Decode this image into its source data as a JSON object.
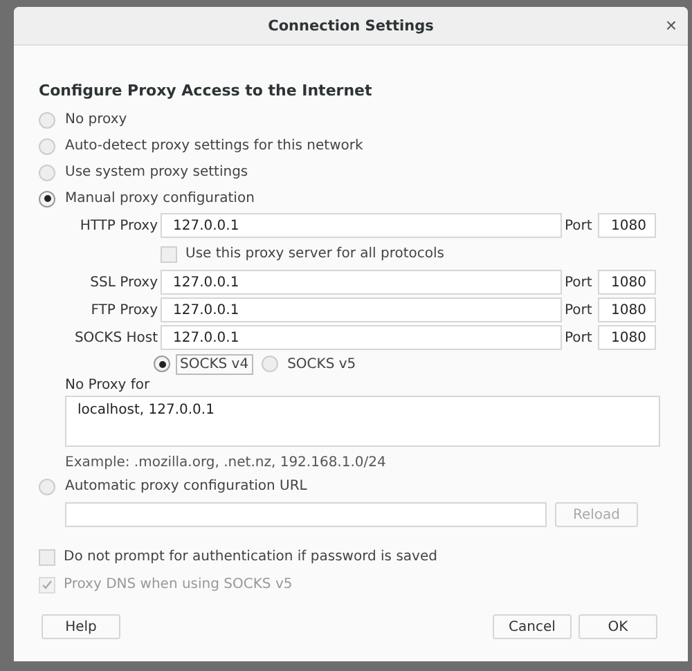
{
  "window": {
    "title": "Connection Settings",
    "close": "×"
  },
  "heading": "Configure Proxy Access to the Internet",
  "modes": [
    {
      "label": "No proxy",
      "selected": false
    },
    {
      "label": "Auto-detect proxy settings for this network",
      "selected": false
    },
    {
      "label": "Use system proxy settings",
      "selected": false
    },
    {
      "label": "Manual proxy configuration",
      "selected": true
    },
    {
      "label": "Automatic proxy configuration URL",
      "selected": false
    }
  ],
  "proxies": [
    {
      "label": "HTTP Proxy",
      "value": "127.0.0.1",
      "port_label": "Port",
      "port": "1080"
    },
    {
      "label": "SSL Proxy",
      "value": "127.0.0.1",
      "port_label": "Port",
      "port": "1080"
    },
    {
      "label": "FTP Proxy",
      "value": "127.0.0.1",
      "port_label": "Port",
      "port": "1080"
    },
    {
      "label": "SOCKS Host",
      "value": "127.0.0.1",
      "port_label": "Port",
      "port": "1080"
    }
  ],
  "share_all": {
    "label": "Use this proxy server for all protocols",
    "checked": false,
    "disabled": false
  },
  "socks_versions": [
    {
      "label": "SOCKS v4",
      "selected": true
    },
    {
      "label": "SOCKS v5",
      "selected": false
    }
  ],
  "no_proxy": {
    "label": "No Proxy for",
    "value": "localhost, 127.0.0.1"
  },
  "example": "Example: .mozilla.org, .net.nz, 192.168.1.0/24",
  "reload": {
    "label": "Reload",
    "disabled": true
  },
  "options": [
    {
      "label": "Do not prompt for authentication if password is saved",
      "checked": false,
      "disabled": false
    },
    {
      "label": "Proxy DNS when using SOCKS v5",
      "checked": true,
      "disabled": true
    }
  ],
  "buttons": {
    "help": "Help",
    "cancel": "Cancel",
    "ok": "OK"
  }
}
